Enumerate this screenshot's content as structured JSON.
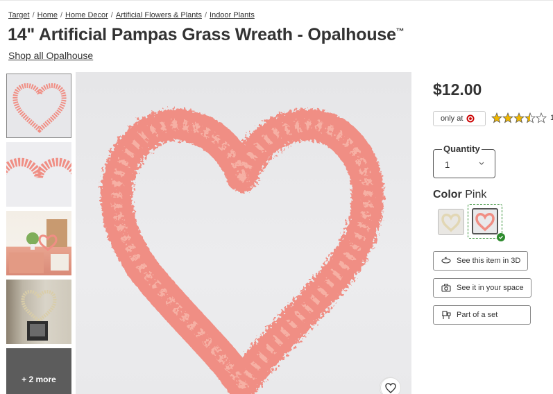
{
  "breadcrumb": [
    "Target",
    "Home",
    "Home Decor",
    "Artificial Flowers & Plants",
    "Indoor Plants"
  ],
  "product": {
    "title": "14\" Artificial Pampas Grass Wreath - Opalhouse",
    "trademark": "™",
    "shop_all": "Shop all Opalhouse",
    "price": "$12.00",
    "only_at": "only at",
    "rating": 3.5,
    "rating_count": "1"
  },
  "gallery": {
    "more_label": "+ 2 more"
  },
  "quantity": {
    "label": "Quantity",
    "value": "1"
  },
  "color": {
    "label": "Color",
    "selected": "Pink"
  },
  "actions": {
    "see_3d": "See this item in 3D",
    "see_space": "See it in your space",
    "part_of_set": "Part of a set"
  },
  "colors": {
    "wreath_pink": "#f08e84",
    "target_red": "#cc0000",
    "star_gold": "#f0b700",
    "selected_green": "#2e8b2e"
  }
}
